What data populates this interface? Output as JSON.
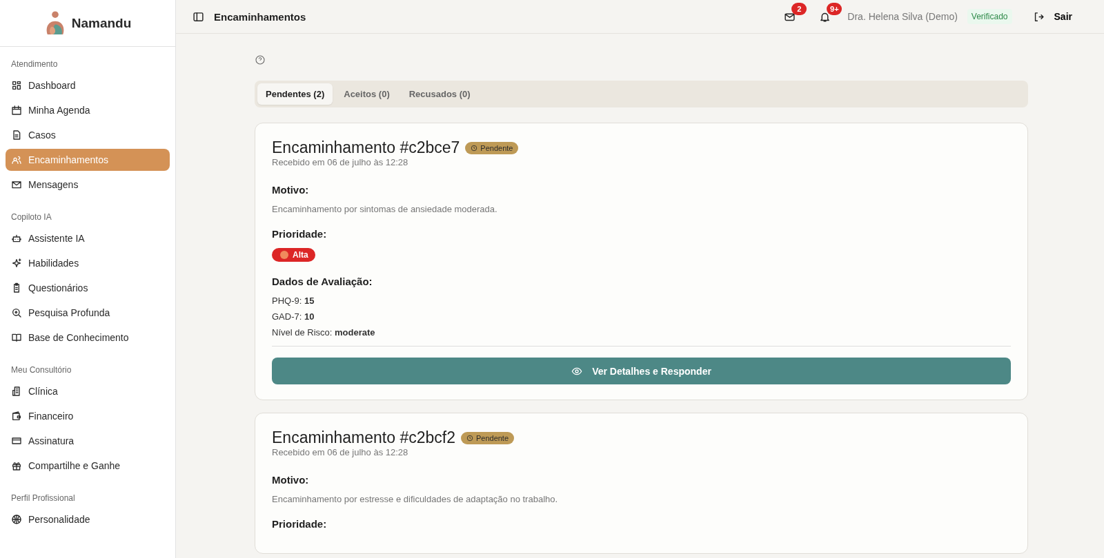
{
  "sidebar": {
    "brand": "Namandu",
    "sections": [
      {
        "title": "Atendimento",
        "items": [
          {
            "label": "Dashboard",
            "selected": false
          },
          {
            "label": "Minha Agenda",
            "selected": false
          },
          {
            "label": "Casos",
            "selected": false
          },
          {
            "label": "Encaminhamentos",
            "selected": true
          },
          {
            "label": "Mensagens",
            "selected": false
          }
        ]
      },
      {
        "title": "Copiloto IA",
        "items": [
          {
            "label": "Assistente IA",
            "selected": false
          },
          {
            "label": "Habilidades",
            "selected": false
          },
          {
            "label": "Questionários",
            "selected": false
          },
          {
            "label": "Pesquisa Profunda",
            "selected": false
          },
          {
            "label": "Base de Conhecimento",
            "selected": false
          }
        ]
      },
      {
        "title": "Meu Consultório",
        "items": [
          {
            "label": "Clínica",
            "selected": false
          },
          {
            "label": "Financeiro",
            "selected": false
          },
          {
            "label": "Assinatura",
            "selected": false
          },
          {
            "label": "Compartilhe e Ganhe",
            "selected": false
          }
        ]
      },
      {
        "title": "Perfil Profissional",
        "items": [
          {
            "label": "Personalidade",
            "selected": false
          }
        ]
      }
    ]
  },
  "topbar": {
    "title": "Encaminhamentos",
    "messages_badge": "2",
    "notifications_badge": "9+",
    "user": "Dra. Helena Silva (Demo)",
    "verified": "Verificado",
    "logout": "Sair"
  },
  "tabs": [
    {
      "label": "Pendentes (2)",
      "selected": true
    },
    {
      "label": "Aceitos (0)",
      "selected": false
    },
    {
      "label": "Recusados (0)",
      "selected": false
    }
  ],
  "referrals": [
    {
      "title": "Encaminhamento #c2bce7",
      "status": "Pendente",
      "received": "Recebido em 06 de julho às 12:28",
      "reason_label": "Motivo:",
      "reason": "Encaminhamento por sintomas de ansiedade moderada.",
      "priority_label": "Prioridade:",
      "priority": {
        "label": "Alta",
        "color": "#dc2626"
      },
      "evaluation_label": "Dados de Avaliação:",
      "evaluation": [
        "PHQ-9: **15**",
        "GAD-7: **10**",
        "Nível de Risco: **moderate**"
      ],
      "action": "Ver Detalhes e Responder"
    },
    {
      "title": "Encaminhamento #c2bcf2",
      "status": "Pendente",
      "received": "Recebido em 06 de julho às 12:28",
      "reason_label": "Motivo:",
      "reason": "Encaminhamento por estresse e dificuldades de adaptação no trabalho.",
      "priority_label": "Prioridade:"
    }
  ]
}
